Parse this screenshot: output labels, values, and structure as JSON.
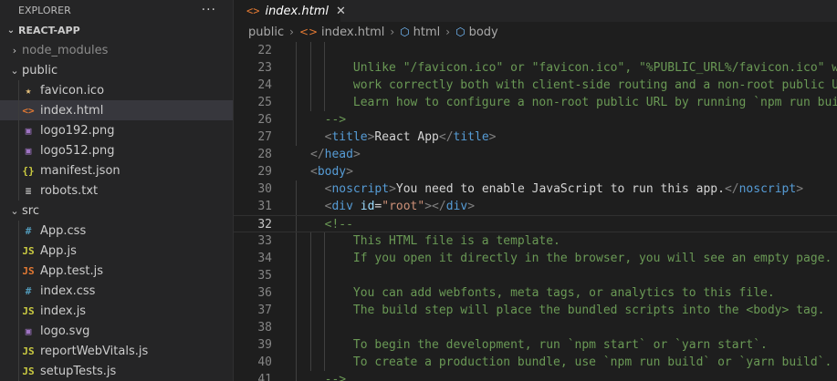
{
  "sidebar": {
    "title": "EXPLORER",
    "more": "···",
    "project": "REACT-APP",
    "items": [
      {
        "label": "node_modules",
        "kind": "folder",
        "expanded": false,
        "depth": 1,
        "dim": true
      },
      {
        "label": "public",
        "kind": "folder",
        "expanded": true,
        "depth": 1
      },
      {
        "label": "favicon.ico",
        "kind": "file",
        "icon": "star-icon",
        "glyph": "★",
        "color": "#e5c07b",
        "depth": 2
      },
      {
        "label": "index.html",
        "kind": "file",
        "icon": "html-icon",
        "glyph": "<>",
        "color": "#e37933",
        "depth": 2,
        "selected": true
      },
      {
        "label": "logo192.png",
        "kind": "file",
        "icon": "image-icon",
        "glyph": "▣",
        "color": "#a074c4",
        "depth": 2
      },
      {
        "label": "logo512.png",
        "kind": "file",
        "icon": "image-icon",
        "glyph": "▣",
        "color": "#a074c4",
        "depth": 2
      },
      {
        "label": "manifest.json",
        "kind": "file",
        "icon": "json-icon",
        "glyph": "{}",
        "color": "#cbcb41",
        "depth": 2
      },
      {
        "label": "robots.txt",
        "kind": "file",
        "icon": "text-icon",
        "glyph": "≡",
        "color": "#cccccc",
        "depth": 2
      },
      {
        "label": "src",
        "kind": "folder",
        "expanded": true,
        "depth": 1
      },
      {
        "label": "App.css",
        "kind": "file",
        "icon": "css-icon",
        "glyph": "#",
        "color": "#519aba",
        "depth": 2
      },
      {
        "label": "App.js",
        "kind": "file",
        "icon": "js-icon",
        "glyph": "JS",
        "color": "#cbcb41",
        "depth": 2
      },
      {
        "label": "App.test.js",
        "kind": "file",
        "icon": "test-icon",
        "glyph": "JS",
        "color": "#e37933",
        "depth": 2
      },
      {
        "label": "index.css",
        "kind": "file",
        "icon": "css-icon",
        "glyph": "#",
        "color": "#519aba",
        "depth": 2
      },
      {
        "label": "index.js",
        "kind": "file",
        "icon": "js-icon",
        "glyph": "JS",
        "color": "#cbcb41",
        "depth": 2
      },
      {
        "label": "logo.svg",
        "kind": "file",
        "icon": "svg-icon",
        "glyph": "▣",
        "color": "#a074c4",
        "depth": 2
      },
      {
        "label": "reportWebVitals.js",
        "kind": "file",
        "icon": "js-icon",
        "glyph": "JS",
        "color": "#cbcb41",
        "depth": 2
      },
      {
        "label": "setupTests.js",
        "kind": "file",
        "icon": "js-icon",
        "glyph": "JS",
        "color": "#cbcb41",
        "depth": 2
      }
    ]
  },
  "tab": {
    "label": "index.html",
    "icon_glyph": "<>",
    "close": "✕"
  },
  "breadcrumb": [
    {
      "label": "public",
      "icon": null
    },
    {
      "label": "index.html",
      "icon": "html-icon",
      "glyph": "<>",
      "color": "#e37933"
    },
    {
      "label": "html",
      "icon": "cube-icon",
      "glyph": "⬡",
      "color": "#75beff"
    },
    {
      "label": "body",
      "icon": "cube-icon",
      "glyph": "⬡",
      "color": "#75beff"
    }
  ],
  "editor": {
    "current_line": 32,
    "lines": [
      {
        "n": 22,
        "indent": 4,
        "tokens": []
      },
      {
        "n": 23,
        "indent": 4,
        "tokens": [
          [
            "cm",
            "Unlike \"/favicon.ico\" or \"favicon.ico\", \"%PUBLIC_URL%/favicon.ico\" will"
          ]
        ]
      },
      {
        "n": 24,
        "indent": 4,
        "tokens": [
          [
            "cm",
            "work correctly both with client-side routing and a non-root public URL."
          ]
        ]
      },
      {
        "n": 25,
        "indent": 4,
        "tokens": [
          [
            "cm",
            "Learn how to configure a non-root public URL by running `npm run build`."
          ]
        ]
      },
      {
        "n": 26,
        "indent": 2,
        "tokens": [
          [
            "cm",
            "-->"
          ]
        ]
      },
      {
        "n": 27,
        "indent": 2,
        "tokens": [
          [
            "br",
            "<"
          ],
          [
            "tg",
            "title"
          ],
          [
            "br",
            ">"
          ],
          [
            "tx",
            "React App"
          ],
          [
            "br",
            "</"
          ],
          [
            "tg",
            "title"
          ],
          [
            "br",
            ">"
          ]
        ]
      },
      {
        "n": 28,
        "indent": 1,
        "tokens": [
          [
            "br",
            "</"
          ],
          [
            "tg",
            "head"
          ],
          [
            "br",
            ">"
          ]
        ]
      },
      {
        "n": 29,
        "indent": 1,
        "tokens": [
          [
            "br",
            "<"
          ],
          [
            "tg",
            "body"
          ],
          [
            "br",
            ">"
          ]
        ]
      },
      {
        "n": 30,
        "indent": 2,
        "tokens": [
          [
            "br",
            "<"
          ],
          [
            "tg",
            "noscript"
          ],
          [
            "br",
            ">"
          ],
          [
            "tx",
            "You need to enable JavaScript to run this app."
          ],
          [
            "br",
            "</"
          ],
          [
            "tg",
            "noscript"
          ],
          [
            "br",
            ">"
          ]
        ]
      },
      {
        "n": 31,
        "indent": 2,
        "tokens": [
          [
            "br",
            "<"
          ],
          [
            "tg",
            "div"
          ],
          [
            "tx",
            " "
          ],
          [
            "at",
            "id"
          ],
          [
            "tx",
            "="
          ],
          [
            "st",
            "\"root\""
          ],
          [
            "br",
            "></"
          ],
          [
            "tg",
            "div"
          ],
          [
            "br",
            ">"
          ]
        ]
      },
      {
        "n": 32,
        "indent": 2,
        "tokens": [
          [
            "cm",
            "<!--"
          ]
        ]
      },
      {
        "n": 33,
        "indent": 4,
        "tokens": [
          [
            "cm",
            "This HTML file is a template."
          ]
        ]
      },
      {
        "n": 34,
        "indent": 4,
        "tokens": [
          [
            "cm",
            "If you open it directly in the browser, you will see an empty page."
          ]
        ]
      },
      {
        "n": 35,
        "indent": 4,
        "tokens": []
      },
      {
        "n": 36,
        "indent": 4,
        "tokens": [
          [
            "cm",
            "You can add webfonts, meta tags, or analytics to this file."
          ]
        ]
      },
      {
        "n": 37,
        "indent": 4,
        "tokens": [
          [
            "cm",
            "The build step will place the bundled scripts into the <body> tag."
          ]
        ]
      },
      {
        "n": 38,
        "indent": 4,
        "tokens": []
      },
      {
        "n": 39,
        "indent": 4,
        "tokens": [
          [
            "cm",
            "To begin the development, run `npm start` or `yarn start`."
          ]
        ]
      },
      {
        "n": 40,
        "indent": 4,
        "tokens": [
          [
            "cm",
            "To create a production bundle, use `npm run build` or `yarn build`."
          ]
        ]
      },
      {
        "n": 41,
        "indent": 2,
        "tokens": [
          [
            "cm",
            "-->"
          ]
        ]
      }
    ]
  }
}
